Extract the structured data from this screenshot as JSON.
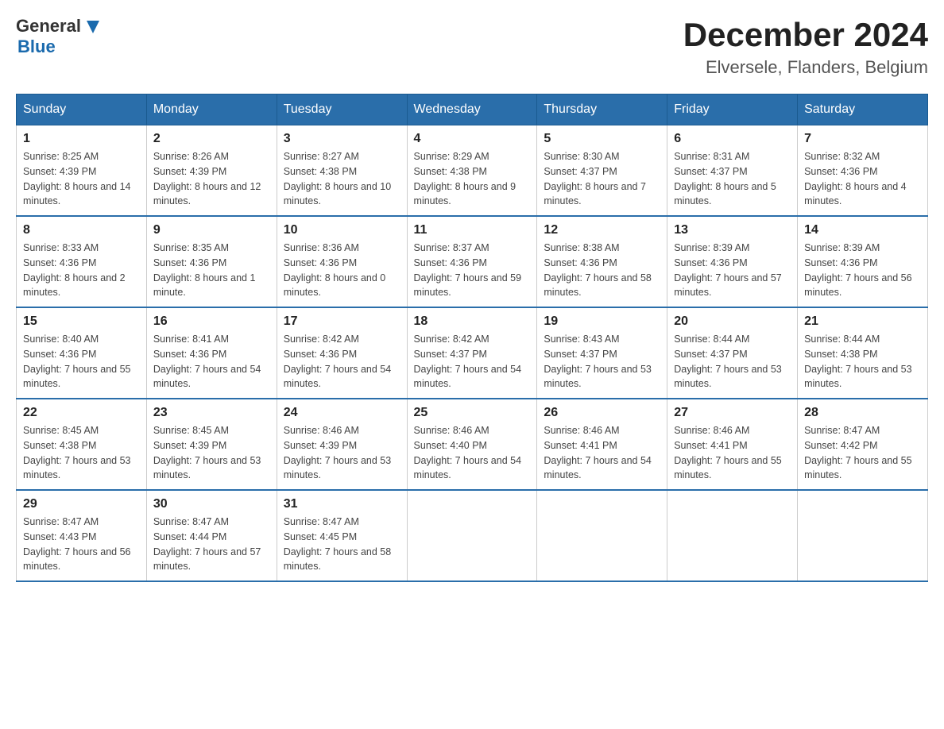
{
  "header": {
    "logo": {
      "general": "General",
      "blue": "Blue"
    },
    "title": "December 2024",
    "subtitle": "Elversele, Flanders, Belgium"
  },
  "weekdays": [
    "Sunday",
    "Monday",
    "Tuesday",
    "Wednesday",
    "Thursday",
    "Friday",
    "Saturday"
  ],
  "weeks": [
    [
      {
        "day": "1",
        "sunrise": "8:25 AM",
        "sunset": "4:39 PM",
        "daylight": "8 hours and 14 minutes."
      },
      {
        "day": "2",
        "sunrise": "8:26 AM",
        "sunset": "4:39 PM",
        "daylight": "8 hours and 12 minutes."
      },
      {
        "day": "3",
        "sunrise": "8:27 AM",
        "sunset": "4:38 PM",
        "daylight": "8 hours and 10 minutes."
      },
      {
        "day": "4",
        "sunrise": "8:29 AM",
        "sunset": "4:38 PM",
        "daylight": "8 hours and 9 minutes."
      },
      {
        "day": "5",
        "sunrise": "8:30 AM",
        "sunset": "4:37 PM",
        "daylight": "8 hours and 7 minutes."
      },
      {
        "day": "6",
        "sunrise": "8:31 AM",
        "sunset": "4:37 PM",
        "daylight": "8 hours and 5 minutes."
      },
      {
        "day": "7",
        "sunrise": "8:32 AM",
        "sunset": "4:36 PM",
        "daylight": "8 hours and 4 minutes."
      }
    ],
    [
      {
        "day": "8",
        "sunrise": "8:33 AM",
        "sunset": "4:36 PM",
        "daylight": "8 hours and 2 minutes."
      },
      {
        "day": "9",
        "sunrise": "8:35 AM",
        "sunset": "4:36 PM",
        "daylight": "8 hours and 1 minute."
      },
      {
        "day": "10",
        "sunrise": "8:36 AM",
        "sunset": "4:36 PM",
        "daylight": "8 hours and 0 minutes."
      },
      {
        "day": "11",
        "sunrise": "8:37 AM",
        "sunset": "4:36 PM",
        "daylight": "7 hours and 59 minutes."
      },
      {
        "day": "12",
        "sunrise": "8:38 AM",
        "sunset": "4:36 PM",
        "daylight": "7 hours and 58 minutes."
      },
      {
        "day": "13",
        "sunrise": "8:39 AM",
        "sunset": "4:36 PM",
        "daylight": "7 hours and 57 minutes."
      },
      {
        "day": "14",
        "sunrise": "8:39 AM",
        "sunset": "4:36 PM",
        "daylight": "7 hours and 56 minutes."
      }
    ],
    [
      {
        "day": "15",
        "sunrise": "8:40 AM",
        "sunset": "4:36 PM",
        "daylight": "7 hours and 55 minutes."
      },
      {
        "day": "16",
        "sunrise": "8:41 AM",
        "sunset": "4:36 PM",
        "daylight": "7 hours and 54 minutes."
      },
      {
        "day": "17",
        "sunrise": "8:42 AM",
        "sunset": "4:36 PM",
        "daylight": "7 hours and 54 minutes."
      },
      {
        "day": "18",
        "sunrise": "8:42 AM",
        "sunset": "4:37 PM",
        "daylight": "7 hours and 54 minutes."
      },
      {
        "day": "19",
        "sunrise": "8:43 AM",
        "sunset": "4:37 PM",
        "daylight": "7 hours and 53 minutes."
      },
      {
        "day": "20",
        "sunrise": "8:44 AM",
        "sunset": "4:37 PM",
        "daylight": "7 hours and 53 minutes."
      },
      {
        "day": "21",
        "sunrise": "8:44 AM",
        "sunset": "4:38 PM",
        "daylight": "7 hours and 53 minutes."
      }
    ],
    [
      {
        "day": "22",
        "sunrise": "8:45 AM",
        "sunset": "4:38 PM",
        "daylight": "7 hours and 53 minutes."
      },
      {
        "day": "23",
        "sunrise": "8:45 AM",
        "sunset": "4:39 PM",
        "daylight": "7 hours and 53 minutes."
      },
      {
        "day": "24",
        "sunrise": "8:46 AM",
        "sunset": "4:39 PM",
        "daylight": "7 hours and 53 minutes."
      },
      {
        "day": "25",
        "sunrise": "8:46 AM",
        "sunset": "4:40 PM",
        "daylight": "7 hours and 54 minutes."
      },
      {
        "day": "26",
        "sunrise": "8:46 AM",
        "sunset": "4:41 PM",
        "daylight": "7 hours and 54 minutes."
      },
      {
        "day": "27",
        "sunrise": "8:46 AM",
        "sunset": "4:41 PM",
        "daylight": "7 hours and 55 minutes."
      },
      {
        "day": "28",
        "sunrise": "8:47 AM",
        "sunset": "4:42 PM",
        "daylight": "7 hours and 55 minutes."
      }
    ],
    [
      {
        "day": "29",
        "sunrise": "8:47 AM",
        "sunset": "4:43 PM",
        "daylight": "7 hours and 56 minutes."
      },
      {
        "day": "30",
        "sunrise": "8:47 AM",
        "sunset": "4:44 PM",
        "daylight": "7 hours and 57 minutes."
      },
      {
        "day": "31",
        "sunrise": "8:47 AM",
        "sunset": "4:45 PM",
        "daylight": "7 hours and 58 minutes."
      },
      null,
      null,
      null,
      null
    ]
  ],
  "labels": {
    "sunrise": "Sunrise:",
    "sunset": "Sunset:",
    "daylight": "Daylight:"
  }
}
